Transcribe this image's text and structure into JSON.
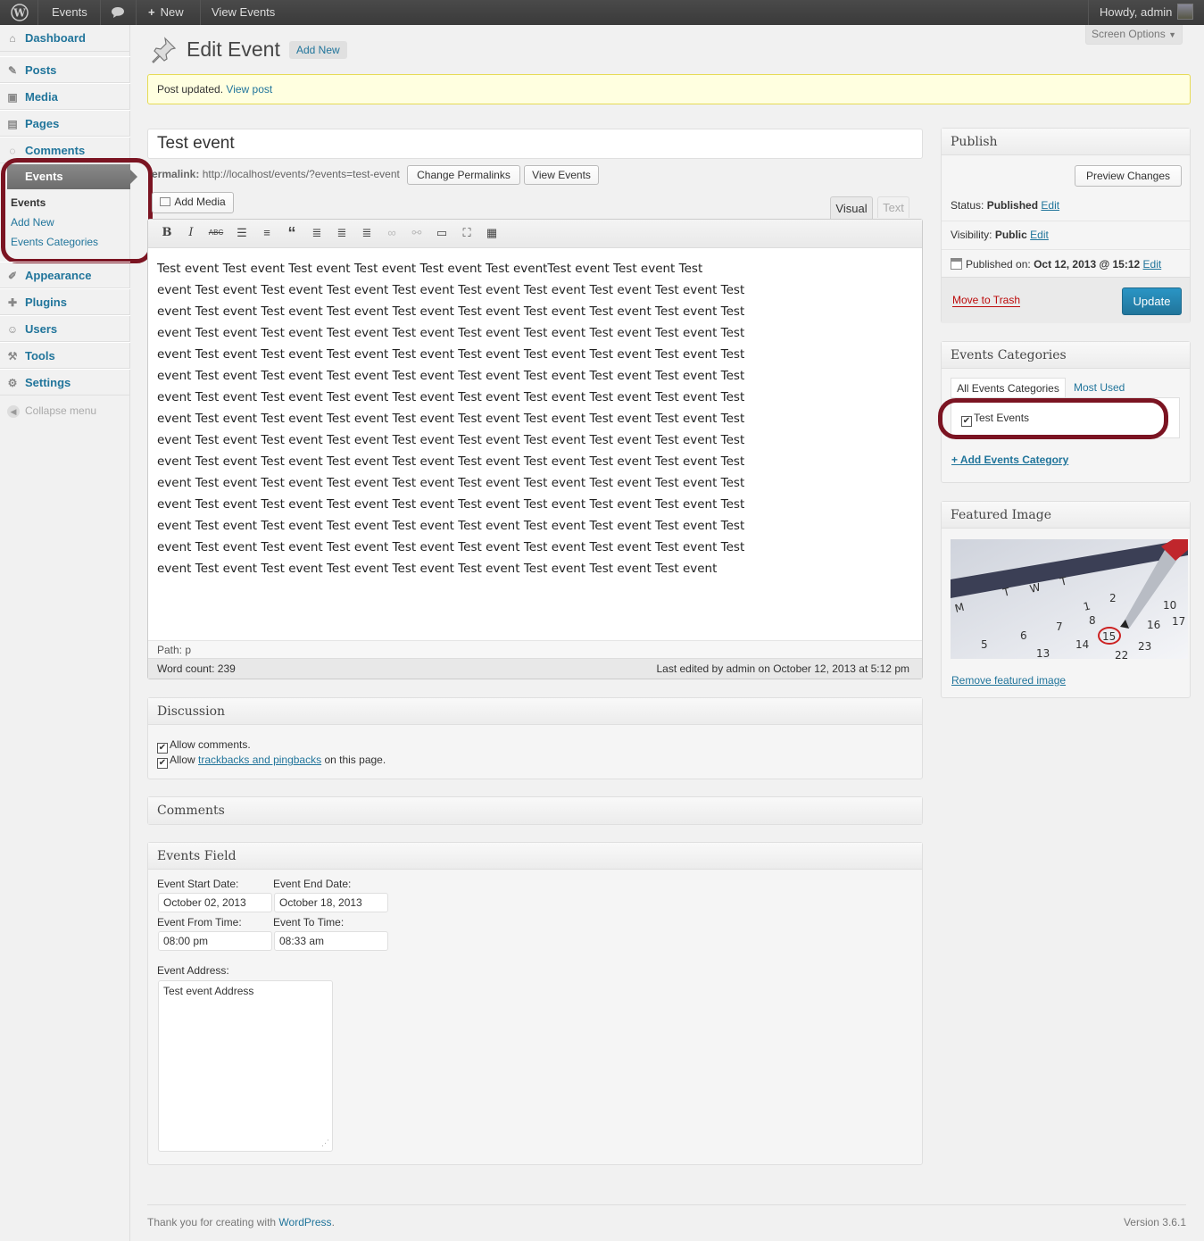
{
  "admin_bar": {
    "wp_logo_icon": "wordpress-logo",
    "site": "Events",
    "comments_icon": "comment-bubble",
    "new_label": "New",
    "view_label": "View Events",
    "howdy": "Howdy, admin"
  },
  "sidebar": {
    "items": [
      {
        "label": "Dashboard",
        "icon": "dashboard-icon"
      },
      {
        "label": "Posts",
        "icon": "pin-icon"
      },
      {
        "label": "Media",
        "icon": "media-icon"
      },
      {
        "label": "Pages",
        "icon": "pages-icon"
      },
      {
        "label": "Comments",
        "icon": "comment-icon"
      },
      {
        "label": "Events",
        "icon": "events-icon"
      },
      {
        "label": "Appearance",
        "icon": "appearance-icon"
      },
      {
        "label": "Plugins",
        "icon": "plugin-icon"
      },
      {
        "label": "Users",
        "icon": "users-icon"
      },
      {
        "label": "Tools",
        "icon": "tools-icon"
      },
      {
        "label": "Settings",
        "icon": "settings-icon"
      }
    ],
    "events_sub": [
      "Events",
      "Add New",
      "Events Categories"
    ],
    "collapse": "Collapse menu"
  },
  "header": {
    "screen_options": "Screen Options",
    "title": "Edit Event",
    "add_new": "Add New"
  },
  "notice": {
    "text": "Post updated.",
    "link": "View post"
  },
  "editor": {
    "post_title": "Test event",
    "permalink_label": "ermalink:",
    "permalink_url": "http://localhost/events/?events=test-event",
    "change_permalinks": "Change Permalinks",
    "view_events": "View Events",
    "add_media": "Add Media",
    "tab_visual": "Visual",
    "tab_text": "Text",
    "lines": [
      "Test event Test event Test event Test event Test event Test eventTest event Test event Test",
      "event Test event Test event Test event Test event Test event Test event Test event Test event Test",
      "event Test event Test event Test event Test event Test event Test event Test event Test event Test",
      "event Test event Test event Test event Test event Test event Test event Test event Test event Test",
      "event Test event Test event Test event Test event Test event Test event Test event Test event Test",
      "event Test event Test event Test event Test event Test event Test event Test event Test event Test",
      "event Test event Test event Test event Test event Test event Test event Test event Test event Test",
      "event Test event Test event Test event Test event Test event Test event Test event Test event Test",
      "event Test event Test event Test event Test event Test event Test event Test event Test event Test",
      "event Test event Test event Test event Test event Test event Test event Test event Test event Test",
      "event Test event Test event Test event Test event Test event Test event Test event Test event Test",
      "event Test event Test event Test event Test event Test event Test event Test event Test event Test",
      "event Test event Test event Test event Test event Test event Test event Test event Test event Test",
      "event Test event Test event Test event Test event Test event Test event Test event Test event Test",
      "event Test event Test event Test event Test event Test event Test event Test event Test event"
    ],
    "path": "Path: p",
    "word_count": "Word count: 239",
    "last_edited": "Last edited by admin on October 12, 2013 at 5:12 pm"
  },
  "discussion": {
    "title": "Discussion",
    "allow_comments": "Allow comments.",
    "allow_prefix": "Allow",
    "trackbacks_link": "trackbacks and pingbacks",
    "allow_suffix": "on this page."
  },
  "comments_box": {
    "title": "Comments"
  },
  "events_field": {
    "title": "Events Field",
    "start_label": "Event Start Date:",
    "start_value": "October 02, 2013",
    "end_label": "Event End Date:",
    "end_value": "October 18, 2013",
    "from_label": "Event From Time:",
    "from_value": "08:00 pm",
    "to_label": "Event To Time:",
    "to_value": "08:33 am",
    "address_label": "Event Address:",
    "address_value": "Test event Address"
  },
  "publish": {
    "title": "Publish",
    "preview": "Preview Changes",
    "status_label": "Status:",
    "status_value": "Published",
    "visibility_label": "Visibility:",
    "visibility_value": "Public",
    "published_label": "Published on:",
    "published_value": "Oct 12, 2013 @ 15:12",
    "edit": "Edit",
    "trash": "Move to Trash",
    "update": "Update"
  },
  "categories": {
    "title": "Events Categories",
    "tab_all": "All Events Categories",
    "tab_most": "Most Used",
    "item": "Test Events",
    "add": "+ Add Events Category"
  },
  "featured": {
    "title": "Featured Image",
    "remove": "Remove featured image"
  },
  "footer": {
    "thanks": "Thank you for creating with",
    "wp_link": "WordPress",
    "version": "Version 3.6.1"
  },
  "colors": {
    "accent": "#21759b",
    "highlight": "#7b1422",
    "update": "#2a95c5",
    "trash": "#bc0b0b"
  }
}
